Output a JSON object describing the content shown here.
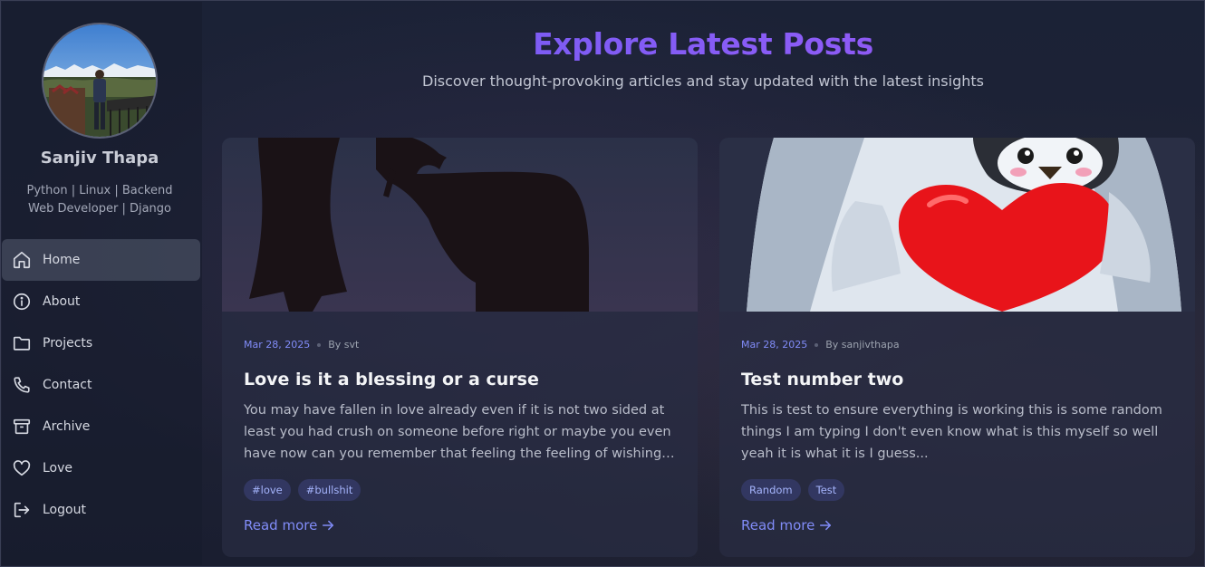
{
  "profile": {
    "name": "Sanjiv Thapa",
    "bio": "Python | Linux | Backend Web Developer | Django"
  },
  "nav": [
    {
      "label": "Home",
      "icon": "home-icon",
      "active": true
    },
    {
      "label": "About",
      "icon": "info-icon"
    },
    {
      "label": "Projects",
      "icon": "folder-icon"
    },
    {
      "label": "Contact",
      "icon": "phone-icon"
    },
    {
      "label": "Archive",
      "icon": "archive-icon"
    },
    {
      "label": "Love",
      "icon": "heart-icon"
    },
    {
      "label": "Logout",
      "icon": "logout-icon"
    }
  ],
  "header": {
    "title": "Explore Latest Posts",
    "subtitle": "Discover thought-provoking articles and stay updated with the latest insights"
  },
  "posts": [
    {
      "date": "Mar 28, 2025",
      "author": "By svt",
      "title": "Love is it a blessing or a curse",
      "excerpt_lines": [
        "You may have fallen in love already even if it is not two sided at",
        "least you had crush on someone before right or maybe you even",
        "have now can you remember that feeling the feeling of wishing t…"
      ],
      "tags": [
        "#love",
        "#bullshit"
      ],
      "read_more": "Read more"
    },
    {
      "date": "Mar 28, 2025",
      "author": "By sanjivthapa",
      "title": "Test number two",
      "excerpt_lines": [
        "This is test to ensure everything is working this is some random",
        "things I am typing I don't even know what is this myself so well",
        "yeah it is what it is I guess..."
      ],
      "tags": [
        "Random",
        "Test"
      ],
      "read_more": "Read more"
    }
  ],
  "colors": {
    "accent": "#818cf8",
    "title_gradient_start": "#6d5cf2",
    "title_gradient_end": "#9b4ff0",
    "background": "#1a1f33"
  }
}
